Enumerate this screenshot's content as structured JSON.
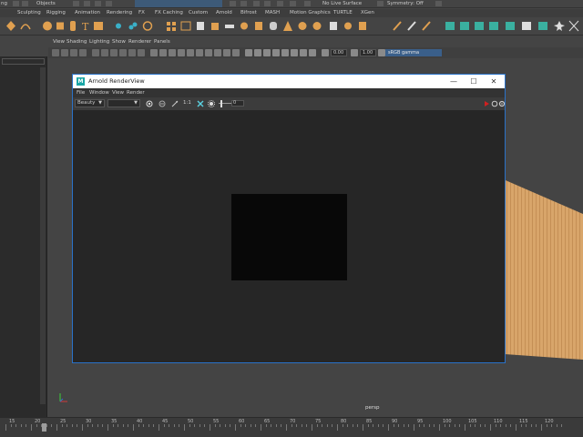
{
  "status_bar": {
    "mode_label": "ng",
    "objects_label": "Objects",
    "live_surface_label": "No Live Surface",
    "symmetry_label": "Symmetry: Off"
  },
  "shelf_tabs": [
    "Sculpting",
    "Rigging",
    "Animation",
    "Rendering",
    "FX",
    "FX Caching",
    "Custom",
    "Arnold",
    "Bifrost",
    "MASH",
    "Motion Graphics",
    "TURTLE",
    "XGen"
  ],
  "viewport": {
    "menu": [
      "View",
      "Shading",
      "Lighting",
      "Show",
      "Renderer",
      "Panels"
    ],
    "exposure_value": "0.00",
    "gamma_value": "1.00",
    "color_space": "sRGB gamma",
    "camera_label": "persp"
  },
  "render_view": {
    "title": "Arnold RenderView",
    "logo_letter": "M",
    "window_controls": {
      "minimize": "—",
      "maximize": "☐",
      "close": "✕"
    },
    "menu": [
      "File",
      "Window",
      "View",
      "Render"
    ],
    "aov_select": "Beauty",
    "camera_select": "",
    "ratio_label": "1:1",
    "slider_value": "0"
  },
  "timeline": {
    "ticks": [
      "15",
      "20",
      "25",
      "30",
      "35",
      "40",
      "45",
      "50",
      "55",
      "60",
      "65",
      "70",
      "75",
      "80",
      "85",
      "90",
      "95",
      "100",
      "105",
      "110",
      "115",
      "120"
    ]
  },
  "colors": {
    "accent_blue": "#2a72c8",
    "arnold_teal": "#1aa6a6",
    "gamma_bg": "#3a5f8a",
    "plane_wood": "#d9a86a"
  }
}
